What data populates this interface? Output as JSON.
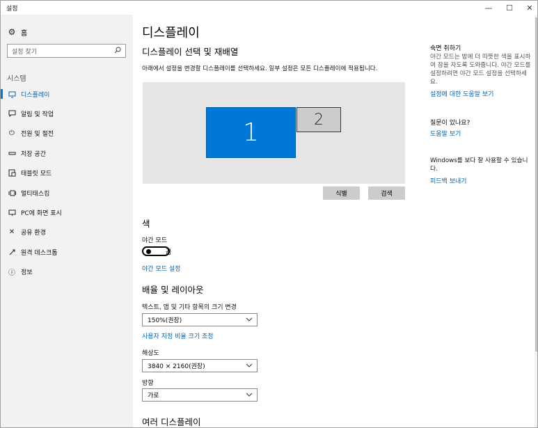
{
  "window": {
    "title": "설정",
    "min_icon": "minimize-icon",
    "max_icon": "maximize-icon",
    "close_icon": "close-icon"
  },
  "sidebar": {
    "home": {
      "label": "홈",
      "icon": "gear-icon"
    },
    "search": {
      "placeholder": "설정 찾기",
      "icon": "search-icon"
    },
    "section_title": "시스템",
    "items": [
      {
        "label": "디스플레이",
        "icon": "display-icon",
        "active": true
      },
      {
        "label": "알림 및 작업",
        "icon": "notification-icon",
        "active": false
      },
      {
        "label": "전원 및 절전",
        "icon": "power-icon",
        "active": false
      },
      {
        "label": "저장 공간",
        "icon": "storage-icon",
        "active": false
      },
      {
        "label": "태블릿 모드",
        "icon": "tablet-icon",
        "active": false
      },
      {
        "label": "멀티태스킹",
        "icon": "multitasking-icon",
        "active": false
      },
      {
        "label": "PC에 화면 표시",
        "icon": "project-icon",
        "active": false
      },
      {
        "label": "공유 환경",
        "icon": "shared-experiences-icon",
        "active": false
      },
      {
        "label": "원격 데스크톱",
        "icon": "remote-desktop-icon",
        "active": false
      },
      {
        "label": "정보",
        "icon": "info-icon",
        "active": false
      }
    ]
  },
  "main": {
    "title": "디스플레이",
    "select_section": {
      "heading": "디스플레이 선택 및 재배열",
      "description": "아래에서 설정을 변경할 디스플레이를 선택하세요. 일부 설정은 모든 디스플레이에 적용됩니다.",
      "monitor1": "1",
      "monitor2": "2",
      "identify_button": "식별",
      "detect_button": "검색"
    },
    "color": {
      "heading": "색",
      "night_light_label": "야간 모드",
      "toggle_state": "끔",
      "night_light_settings_link": "야간 모드 설정"
    },
    "scale_layout": {
      "heading": "배율 및 레이아웃",
      "scale_label": "텍스트, 앱 및 기타 항목의 크기 변경",
      "scale_value": "150%(권장)",
      "custom_scaling_link": "사용자 지정 비율 크기 조정",
      "resolution_label": "해상도",
      "resolution_value": "3840 × 2160(권장)",
      "orientation_label": "방향",
      "orientation_value": "가로"
    },
    "multiple_displays": {
      "heading": "여러 디스플레이"
    }
  },
  "right_panel": {
    "sleep": {
      "heading": "숙면 취하기",
      "text": "야간 모드는 밤에 더 따뜻한 색을 표시하여 잠을 자도록 도와줍니다. 야간 모드를 설정하려면 야간 모드 설정을 선택하세요.",
      "link": "설정에 대한 도움말 보기"
    },
    "question": {
      "heading": "질문이 있나요?",
      "link": "도움말 보기"
    },
    "feedback": {
      "text": "Windows를 보다 잘 사용할 수 있습니다.",
      "link": "피드백 보내기"
    }
  },
  "colors": {
    "accent": "#0078d7",
    "link": "#0063b1",
    "sidebar_bg": "#f2f2f2"
  }
}
